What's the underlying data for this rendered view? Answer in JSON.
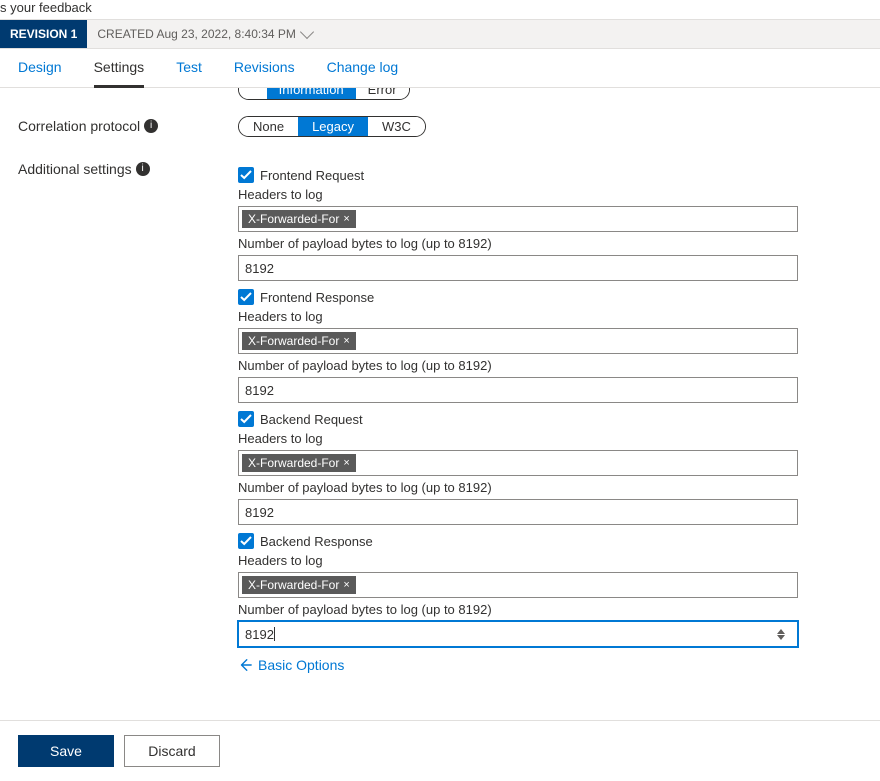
{
  "feedback_fragment": "s your feedback",
  "revision": {
    "badge": "REVISION 1",
    "meta": "CREATED Aug 23, 2022, 8:40:34 PM"
  },
  "tabs": {
    "design": "Design",
    "settings": "Settings",
    "test": "Test",
    "revisions": "Revisions",
    "changelog": "Change log"
  },
  "cutoff_pill": {
    "left_visible": "",
    "middle": "Information",
    "right": "Error"
  },
  "labels": {
    "correlation": "Correlation protocol",
    "additional": "Additional settings"
  },
  "correlation_options": {
    "none": "None",
    "legacy": "Legacy",
    "w3c": "W3C"
  },
  "sections": [
    {
      "title": "Frontend Request",
      "headers_label": "Headers to log",
      "tag": "X-Forwarded-For",
      "bytes_label": "Number of payload bytes to log (up to 8192)",
      "bytes_value": "8192",
      "focused": false
    },
    {
      "title": "Frontend Response",
      "headers_label": "Headers to log",
      "tag": "X-Forwarded-For",
      "bytes_label": "Number of payload bytes to log (up to 8192)",
      "bytes_value": "8192",
      "focused": false
    },
    {
      "title": "Backend Request",
      "headers_label": "Headers to log",
      "tag": "X-Forwarded-For",
      "bytes_label": "Number of payload bytes to log (up to 8192)",
      "bytes_value": "8192",
      "focused": false
    },
    {
      "title": "Backend Response",
      "headers_label": "Headers to log",
      "tag": "X-Forwarded-For",
      "bytes_label": "Number of payload bytes to log (up to 8192)",
      "bytes_value": "8192",
      "focused": true
    }
  ],
  "basic_options": "Basic Options",
  "footer": {
    "save": "Save",
    "discard": "Discard"
  }
}
